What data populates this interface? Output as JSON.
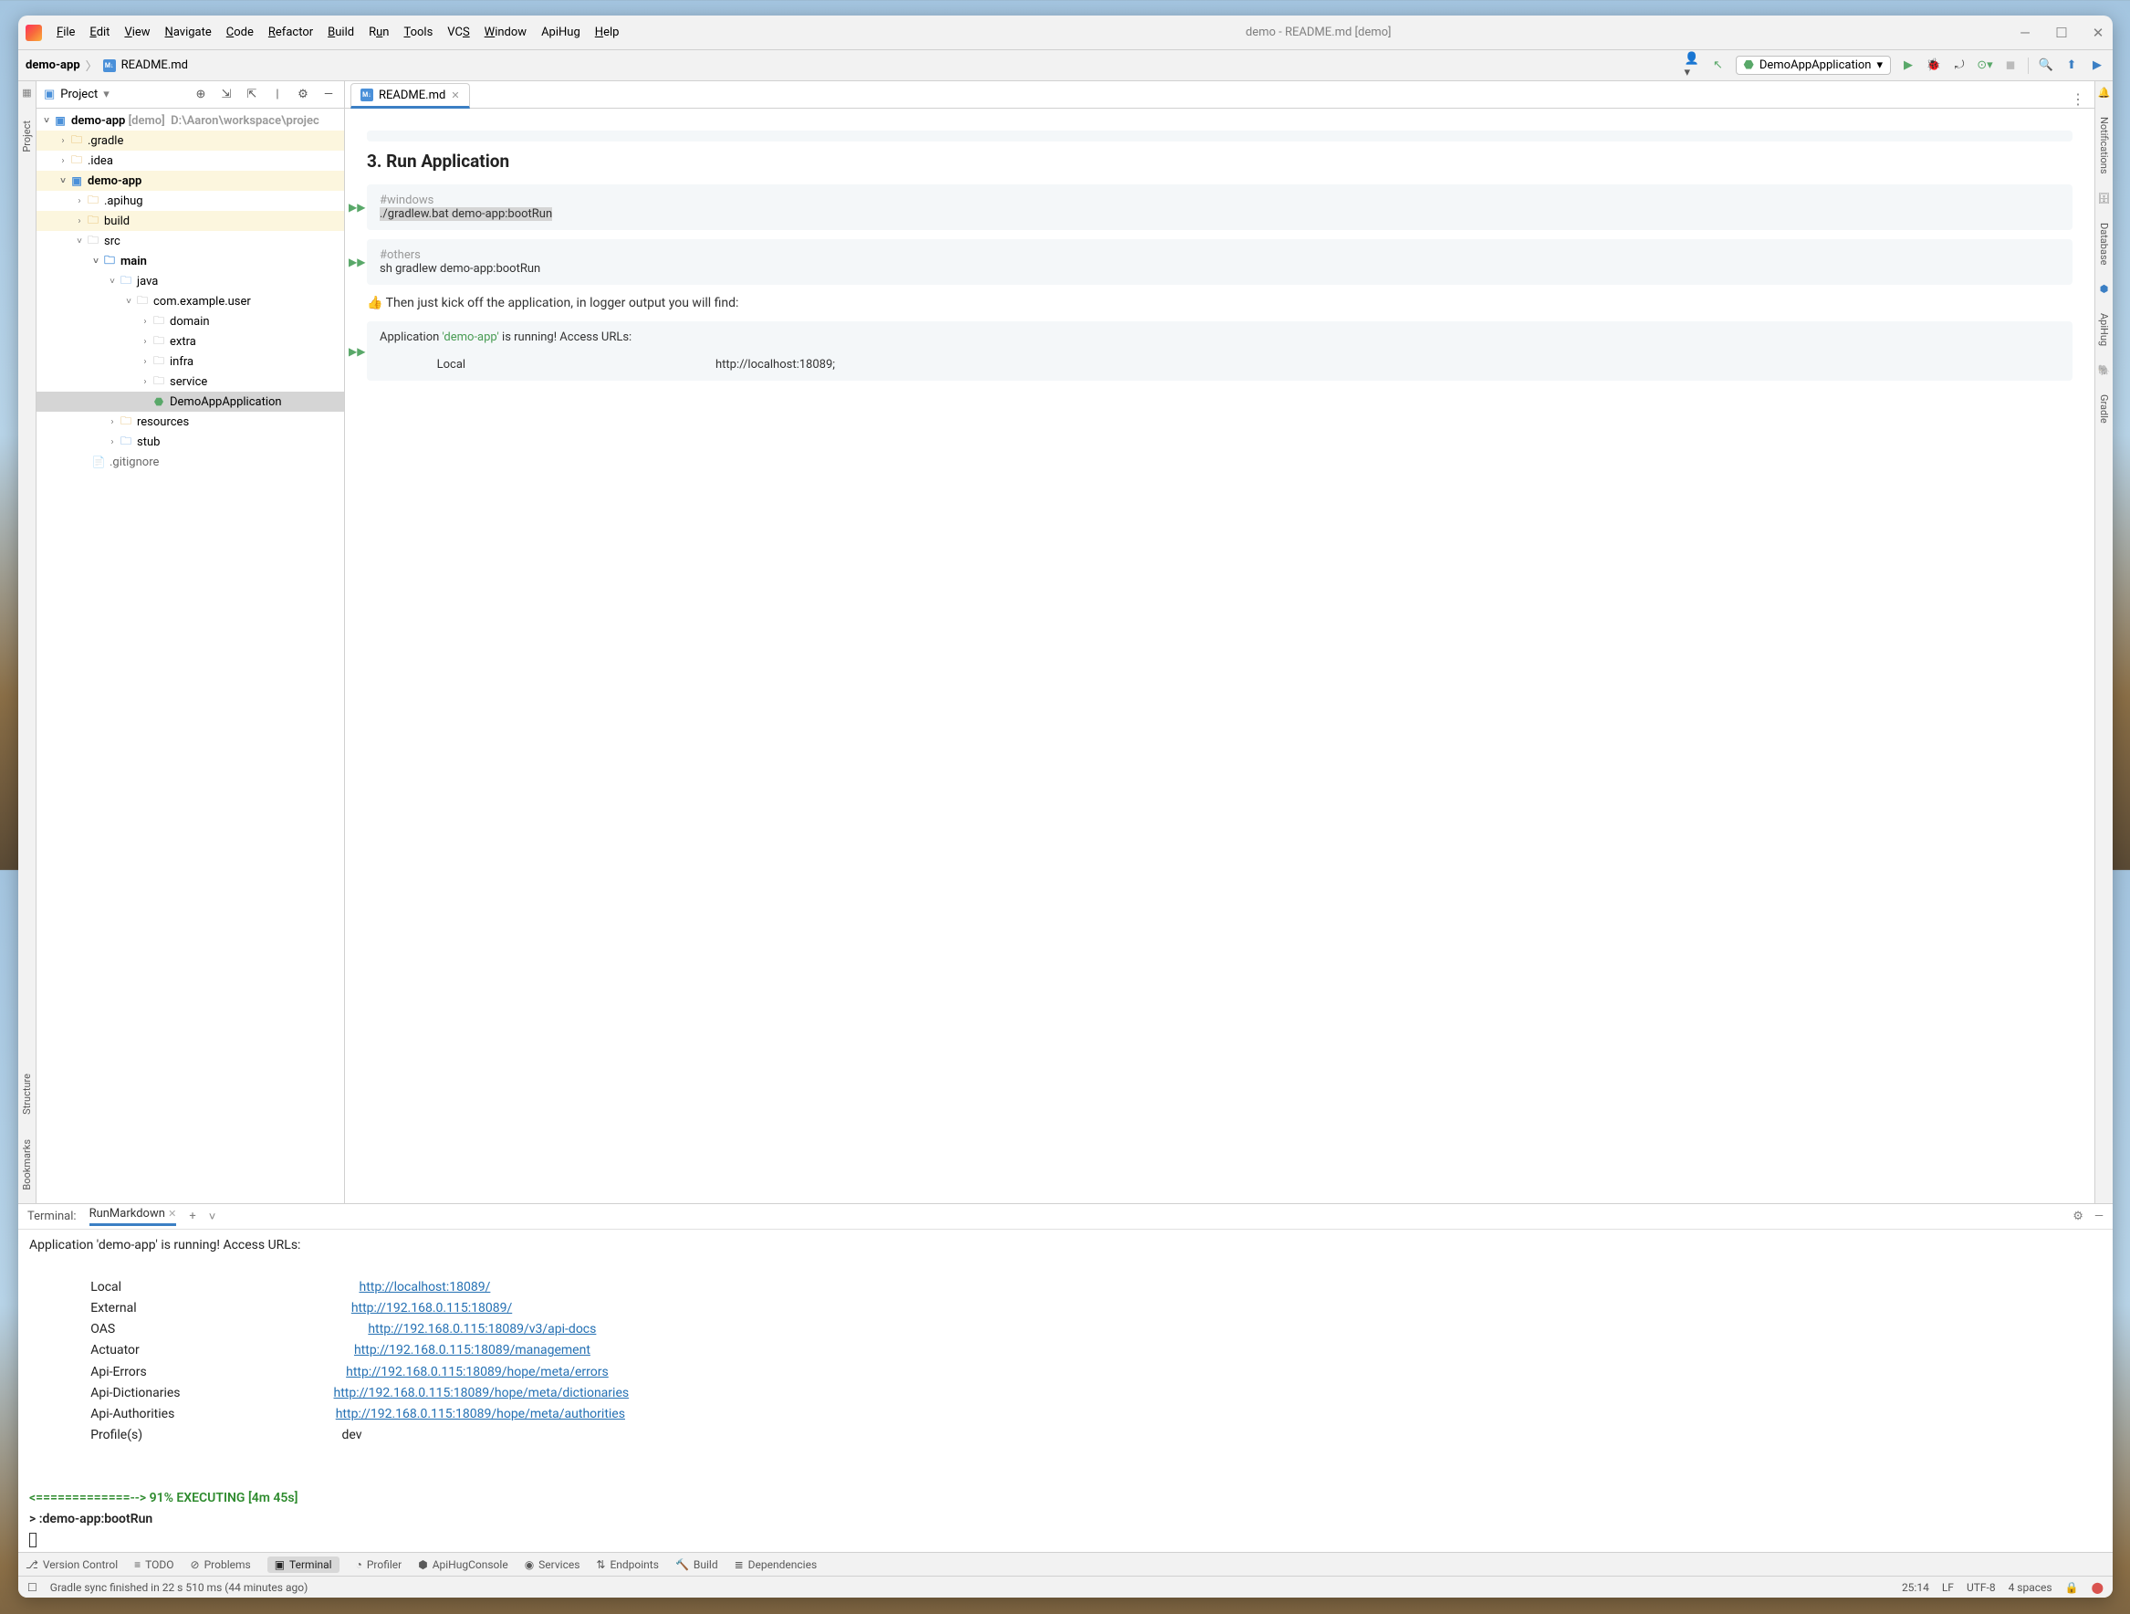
{
  "menu": [
    "File",
    "Edit",
    "View",
    "Navigate",
    "Code",
    "Refactor",
    "Build",
    "Run",
    "Tools",
    "VCS",
    "Window",
    "ApiHug",
    "Help"
  ],
  "title": "demo - README.md [demo]",
  "breadcrumb": {
    "root": "demo-app",
    "file": "README.md"
  },
  "runConfig": "DemoAppApplication",
  "projectLabel": "Project",
  "tree": {
    "root": {
      "name": "demo-app",
      "tag": "[demo]",
      "path": "D:\\Aaron\\workspace\\projec"
    },
    "gradle": ".gradle",
    "idea": ".idea",
    "demoapp": "demo-app",
    "apihug": ".apihug",
    "build": "build",
    "src": "src",
    "main": "main",
    "java": "java",
    "pkg": "com.example.user",
    "domain": "domain",
    "extra": "extra",
    "infra": "infra",
    "service": "service",
    "appclass": "DemoAppApplication",
    "resources": "resources",
    "stub": "stub",
    "gitignore": ".gitignore"
  },
  "editor": {
    "tab": "README.md",
    "heading": "3. Run Application",
    "code1_cmt": "#windows",
    "code1_cmd": "./gradlew.bat demo-app:bootRun",
    "code2_cmt": "#others",
    "code2_cmd": "sh gradlew demo-app:bootRun",
    "line": "👍 Then just kick off the application, in logger output you will find:",
    "code3_pre": "Application ",
    "code3_app": "'demo-app'",
    "code3_post": " is running! Access URLs:",
    "code3_local_lbl": "Local",
    "code3_local_url": "http://localhost:18089;"
  },
  "terminal": {
    "tab0": "Terminal:",
    "tab1": "RunMarkdown",
    "header": "Application 'demo-app' is running! Access URLs:",
    "rows": [
      {
        "k": "Local",
        "v": "http://localhost:18089/"
      },
      {
        "k": "External",
        "v": "http://192.168.0.115:18089/"
      },
      {
        "k": "OAS",
        "v": "http://192.168.0.115:18089/v3/api-docs"
      },
      {
        "k": "Actuator",
        "v": "http://192.168.0.115:18089/management"
      },
      {
        "k": "Api-Errors",
        "v": "http://192.168.0.115:18089/hope/meta/errors"
      },
      {
        "k": "Api-Dictionaries",
        "v": "http://192.168.0.115:18089/hope/meta/dictionaries"
      },
      {
        "k": "Api-Authorities",
        "v": "http://192.168.0.115:18089/hope/meta/authorities"
      }
    ],
    "profilek": "Profile(s)",
    "profilev": "dev",
    "exec": "<=============--> 91% EXECUTING [4m 45s]",
    "task": "> :demo-app:bootRun"
  },
  "bottomTabs": [
    "Version Control",
    "TODO",
    "Problems",
    "Terminal",
    "Profiler",
    "ApiHugConsole",
    "Services",
    "Endpoints",
    "Build",
    "Dependencies"
  ],
  "leftRail": [
    "Project",
    "Structure",
    "Bookmarks"
  ],
  "rightRail": [
    "Notifications",
    "Database",
    "ApiHug",
    "Gradle"
  ],
  "status": {
    "msg": "Gradle sync finished in 22 s 510 ms (44 minutes ago)",
    "pos": "25:14",
    "lf": "LF",
    "enc": "UTF-8",
    "indent": "4 spaces"
  }
}
